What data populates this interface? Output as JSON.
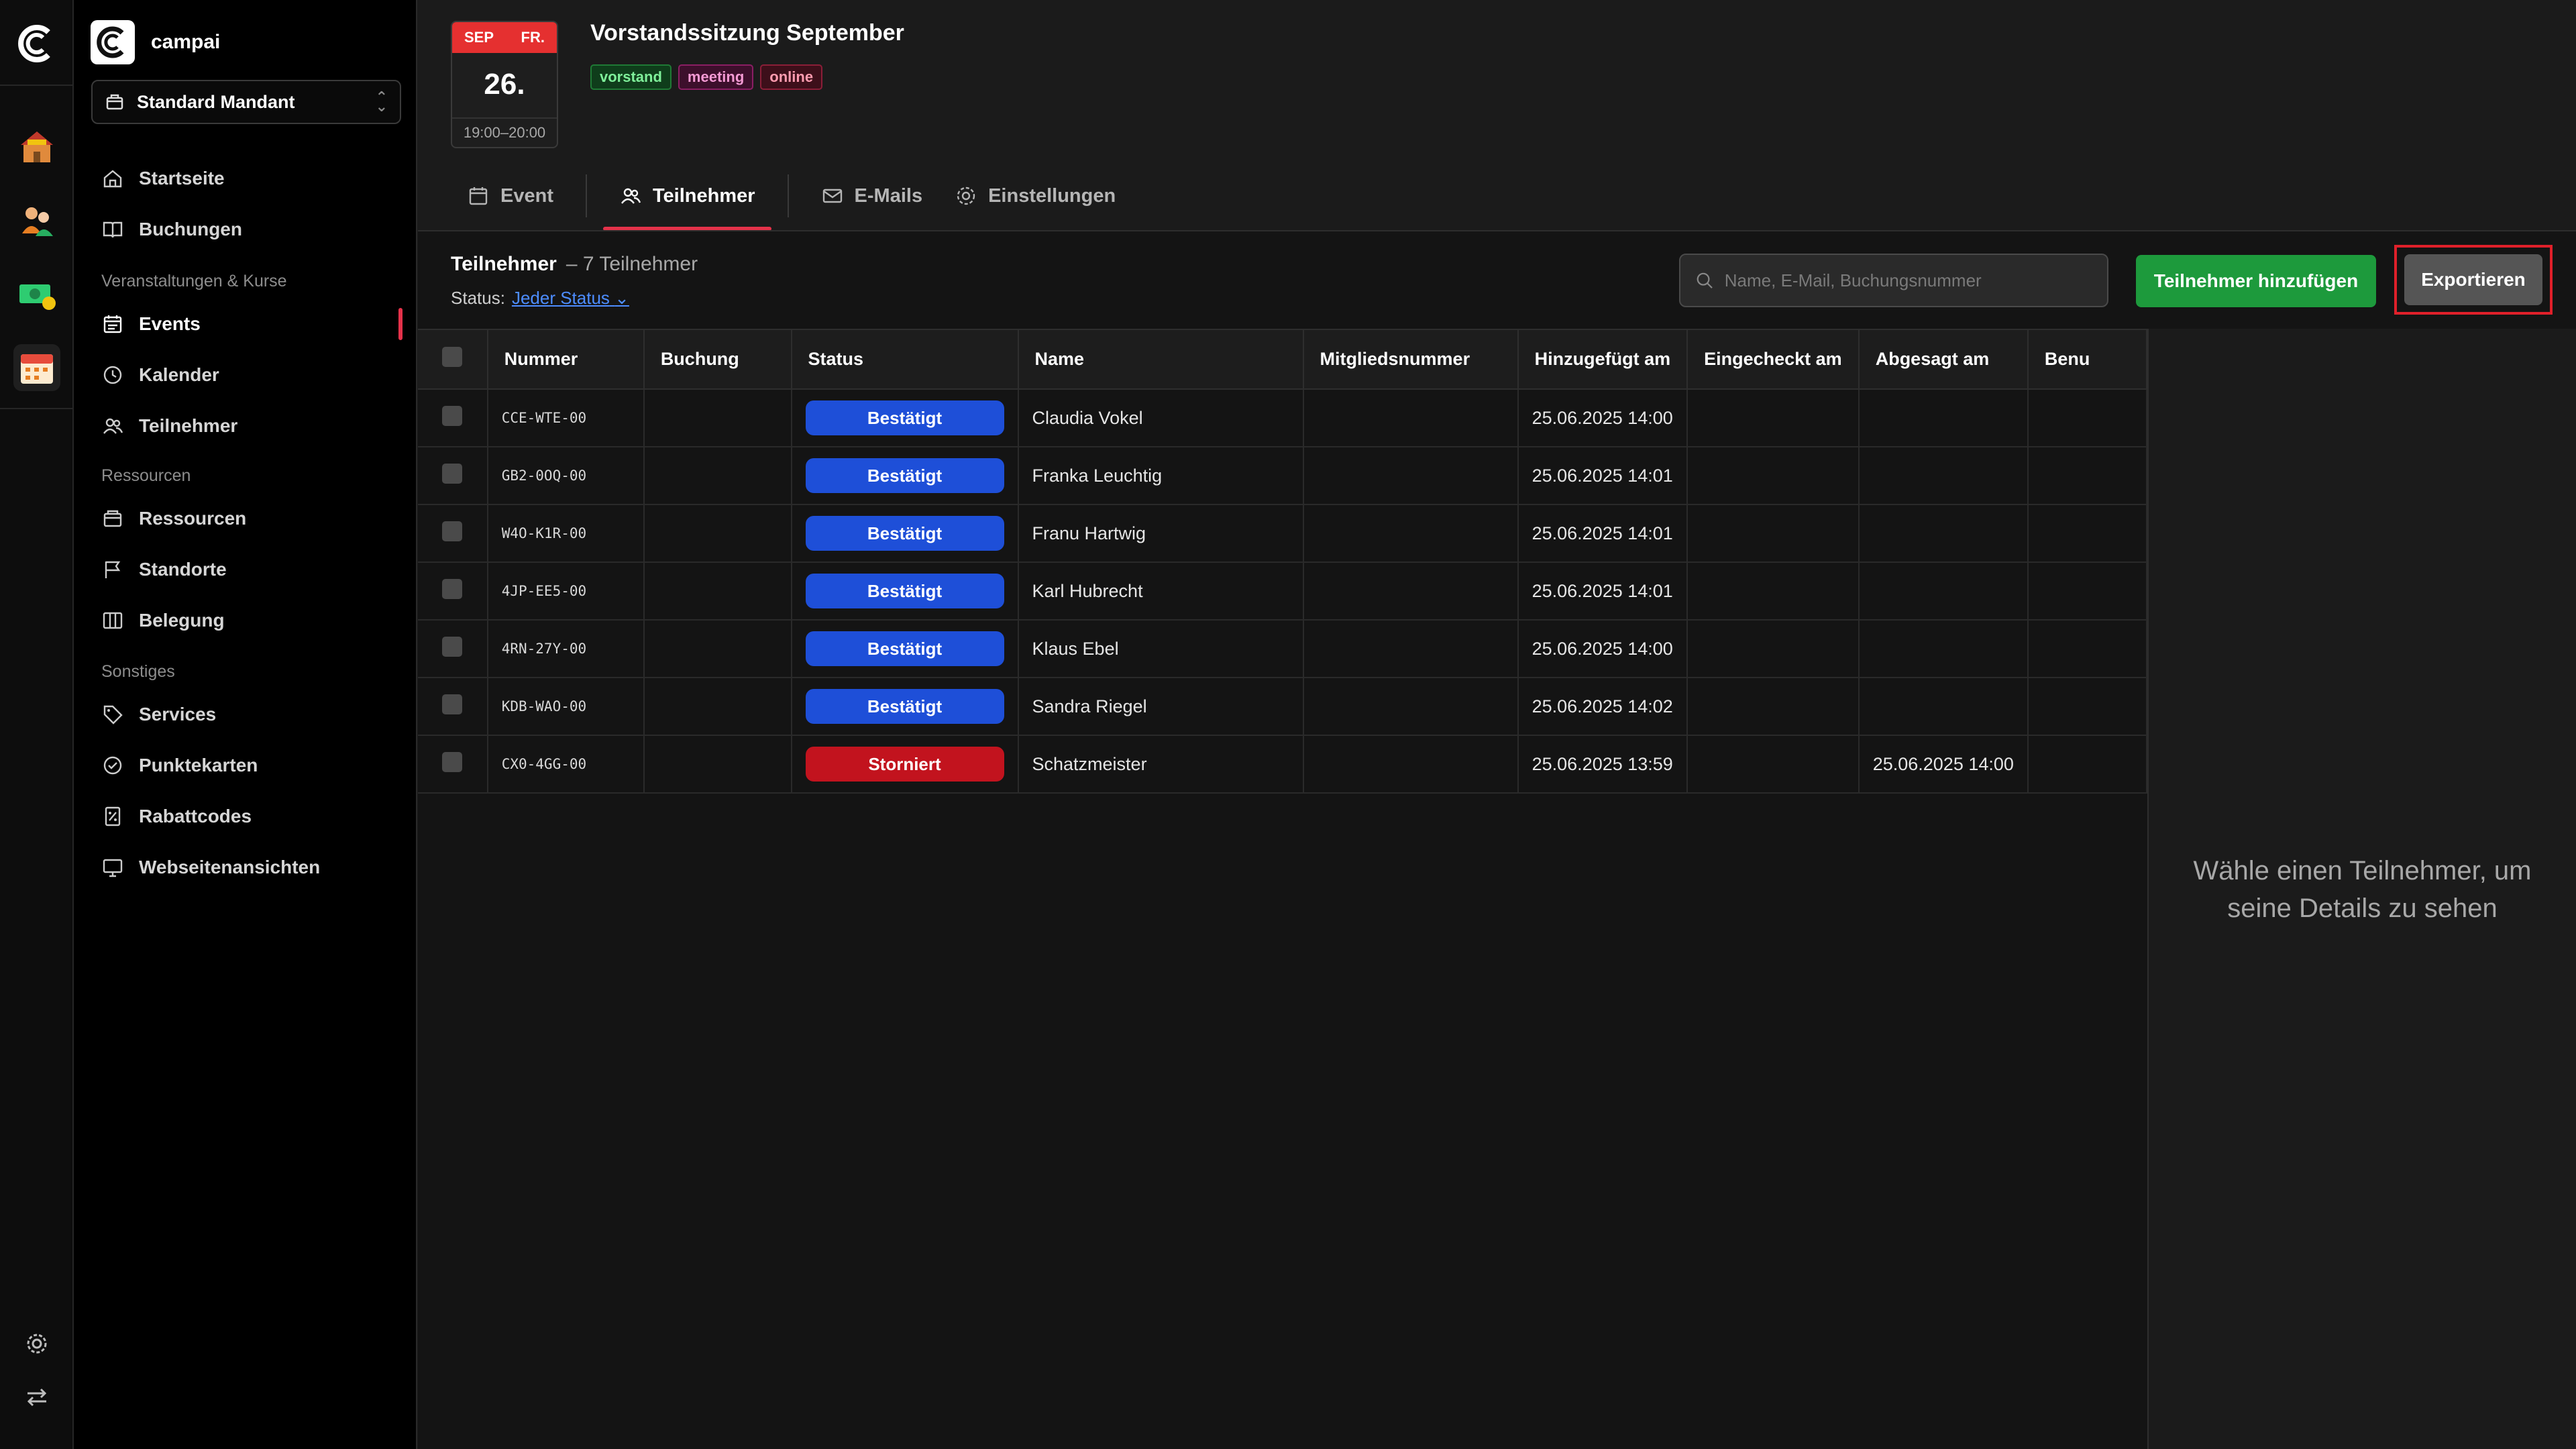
{
  "app": {
    "name": "campai",
    "tenant": "Standard Mandant"
  },
  "nav": {
    "items_top": [
      {
        "label": "Startseite"
      },
      {
        "label": "Buchungen"
      }
    ],
    "section1": "Veranstaltungen & Kurse",
    "items_events": [
      {
        "label": "Events"
      },
      {
        "label": "Kalender"
      },
      {
        "label": "Teilnehmer"
      }
    ],
    "section2": "Ressourcen",
    "items_resources": [
      {
        "label": "Ressourcen"
      },
      {
        "label": "Standorte"
      },
      {
        "label": "Belegung"
      }
    ],
    "section3": "Sonstiges",
    "items_misc": [
      {
        "label": "Services"
      },
      {
        "label": "Punktekarten"
      },
      {
        "label": "Rabattcodes"
      },
      {
        "label": "Webseitenansichten"
      }
    ]
  },
  "event": {
    "month": "SEP",
    "weekday": "FR.",
    "day": "26.",
    "time": "19:00–20:00",
    "title": "Vorstandssitzung September",
    "tags": [
      "vorstand",
      "meeting",
      "online"
    ]
  },
  "tabs": [
    "Event",
    "Teilnehmer",
    "E-Mails",
    "Einstellungen"
  ],
  "toolbar": {
    "title": "Teilnehmer",
    "count": "– 7 Teilnehmer",
    "status_label": "Status:",
    "status_value": "Jeder Status",
    "search_placeholder": "Name, E-Mail, Buchungsnummer",
    "add_label": "Teilnehmer hinzufügen",
    "export_label": "Exportieren"
  },
  "table": {
    "columns": [
      "Nummer",
      "Buchung",
      "Status",
      "Name",
      "Mitgliedsnummer",
      "Hinzugefügt am",
      "Eingecheckt am",
      "Abgesagt am",
      "Benu"
    ],
    "rows": [
      {
        "nummer": "CCE-WTE-00",
        "buchung": "",
        "status": "Bestätigt",
        "status_color": "#1e4fd8",
        "name": "Claudia Vokel",
        "mitglied": "",
        "hinzu": "25.06.2025 14:00",
        "eingecheckt": "",
        "abgesagt": ""
      },
      {
        "nummer": "GB2-0OQ-00",
        "buchung": "",
        "status": "Bestätigt",
        "status_color": "#1e4fd8",
        "name": "Franka Leuchtig",
        "mitglied": "",
        "hinzu": "25.06.2025 14:01",
        "eingecheckt": "",
        "abgesagt": ""
      },
      {
        "nummer": "W4O-K1R-00",
        "buchung": "",
        "status": "Bestätigt",
        "status_color": "#1e4fd8",
        "name": "Franu Hartwig",
        "mitglied": "",
        "hinzu": "25.06.2025 14:01",
        "eingecheckt": "",
        "abgesagt": ""
      },
      {
        "nummer": "4JP-EE5-00",
        "buchung": "",
        "status": "Bestätigt",
        "status_color": "#1e4fd8",
        "name": "Karl Hubrecht",
        "mitglied": "",
        "hinzu": "25.06.2025 14:01",
        "eingecheckt": "",
        "abgesagt": ""
      },
      {
        "nummer": "4RN-27Y-00",
        "buchung": "",
        "status": "Bestätigt",
        "status_color": "#1e4fd8",
        "name": "Klaus Ebel",
        "mitglied": "",
        "hinzu": "25.06.2025 14:00",
        "eingecheckt": "",
        "abgesagt": ""
      },
      {
        "nummer": "KDB-WAO-00",
        "buchung": "",
        "status": "Bestätigt",
        "status_color": "#1e4fd8",
        "name": "Sandra Riegel",
        "mitglied": "",
        "hinzu": "25.06.2025 14:02",
        "eingecheckt": "",
        "abgesagt": ""
      },
      {
        "nummer": "CX0-4GG-00",
        "buchung": "",
        "status": "Storniert",
        "status_color": "#c2131e",
        "name": "Schatzmeister",
        "mitglied": "",
        "hinzu": "25.06.2025 13:59",
        "eingecheckt": "",
        "abgesagt": "25.06.2025 14:00"
      }
    ]
  },
  "detail": {
    "empty_message": "Wähle einen Teilnehmer, um seine Details zu sehen"
  }
}
